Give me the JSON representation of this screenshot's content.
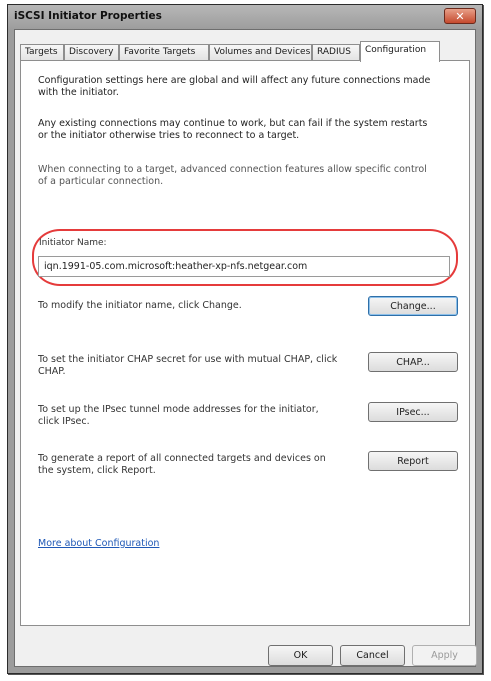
{
  "window": {
    "title": "iSCSI Initiator Properties",
    "close_symbol": "✕"
  },
  "tabs": [
    {
      "label": "Targets"
    },
    {
      "label": "Discovery"
    },
    {
      "label": "Favorite Targets"
    },
    {
      "label": "Volumes and Devices"
    },
    {
      "label": "RADIUS"
    },
    {
      "label": "Configuration"
    }
  ],
  "active_tab": "Configuration",
  "config": {
    "intro": "Configuration settings here are global and will affect any future connections made with the initiator.",
    "existing": "Any existing connections may continue to work, but can fail if the system restarts or the initiator otherwise tries to reconnect to a target.",
    "target_note": "When connecting to a target, advanced connection features allow specific control of a particular connection.",
    "initiator_label": "Initiator Name:",
    "initiator_name": "iqn.1991-05.com.microsoft:heather-xp-nfs.netgear.com"
  },
  "actions": [
    {
      "text": "To modify the initiator name, click Change.",
      "button": "Change..."
    },
    {
      "text": "To set the initiator CHAP secret for use with mutual CHAP, click CHAP.",
      "button": "CHAP..."
    },
    {
      "text": "To set up the IPsec tunnel mode addresses for the initiator, click IPsec.",
      "button": "IPsec..."
    },
    {
      "text": "To generate a report of all connected targets and devices on the system, click Report.",
      "button": "Report"
    }
  ],
  "link": "More about Configuration",
  "dialog_buttons": {
    "ok": "OK",
    "cancel": "Cancel",
    "apply": "Apply"
  }
}
